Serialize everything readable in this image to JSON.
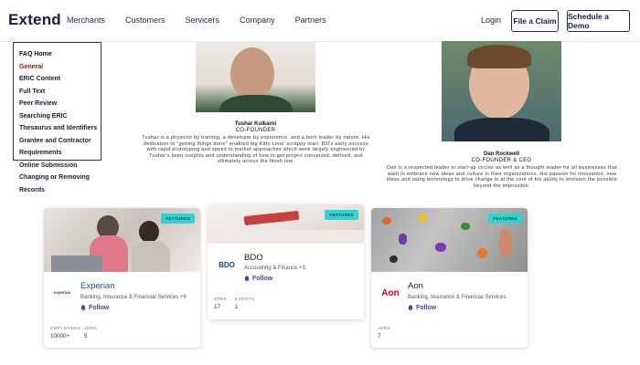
{
  "nav": {
    "logo": "Extend",
    "links": [
      "Merchants",
      "Customers",
      "Servicers",
      "Company",
      "Partners"
    ],
    "login": "Login",
    "file_claim": "File a Claim",
    "schedule_demo": "Schedule a Demo"
  },
  "faq": {
    "items": [
      "FAQ Home",
      "General",
      "ERIC Content",
      "Full Text",
      "Peer Review",
      "Searching ERIC",
      "Thesaurus and Identifiers",
      "Grantee and Contractor",
      "Requirements",
      "Online Submission",
      "Changing or Removing",
      "Records"
    ]
  },
  "founders": [
    {
      "name": "Tushar Kulkarni",
      "title": "CO-FOUNDER",
      "bio": "Tushar is a physicist by training, a developer by experience, and a born leader by nature. His dedication to \"getting things done\" enabled big Kitty Loos' scrappy start. Bill's early success with rapid prototyping and speed to market approaches which were largely engineered by Tushar's keen insights and understanding of how to get project conceived, defined, and ultimately across the finish line."
    },
    {
      "name": "Dan Rockwell",
      "title": "CO-FOUNDER & CEO",
      "bio": "Dan is a respected leader in start-up circles as well as a thought leader for all businesses that want to embrace new ideas and culture in their organizations. His passion for innovation, new ideas and using technology to drive change is at the core of his ability to envision the possible beyond the impossible."
    }
  ],
  "cards": [
    {
      "badge": "FEATURED",
      "logo_text": "experian",
      "name": "Experian",
      "industry": "Banking, Insurance & Financial Services +6",
      "follow": "Follow",
      "stats": [
        {
          "label": "EMPLOYEES",
          "value": "10000+"
        },
        {
          "label": "JOBS",
          "value": "5"
        }
      ]
    },
    {
      "badge": "FEATURED",
      "logo_text": "BDO",
      "name": "BDO",
      "industry": "Accounting & Finance +3",
      "follow": "Follow",
      "stats": [
        {
          "label": "JOBS",
          "value": "17"
        },
        {
          "label": "EVENTS",
          "value": "1"
        }
      ]
    },
    {
      "badge": "FEATURED",
      "logo_text": "Aon",
      "name": "Aon",
      "industry": "Banking, Insurance & Financial Services",
      "follow": "Follow",
      "stats": [
        {
          "label": "JOBS",
          "value": "7"
        }
      ]
    }
  ],
  "colors": {
    "accent": "#4b3bb0",
    "badge": "#36d0d0",
    "faq_active": "#8b1a1a",
    "nav_border": "#222a6b",
    "aon_red": "#e3001b",
    "bdo_blue": "#1b3f9a"
  }
}
